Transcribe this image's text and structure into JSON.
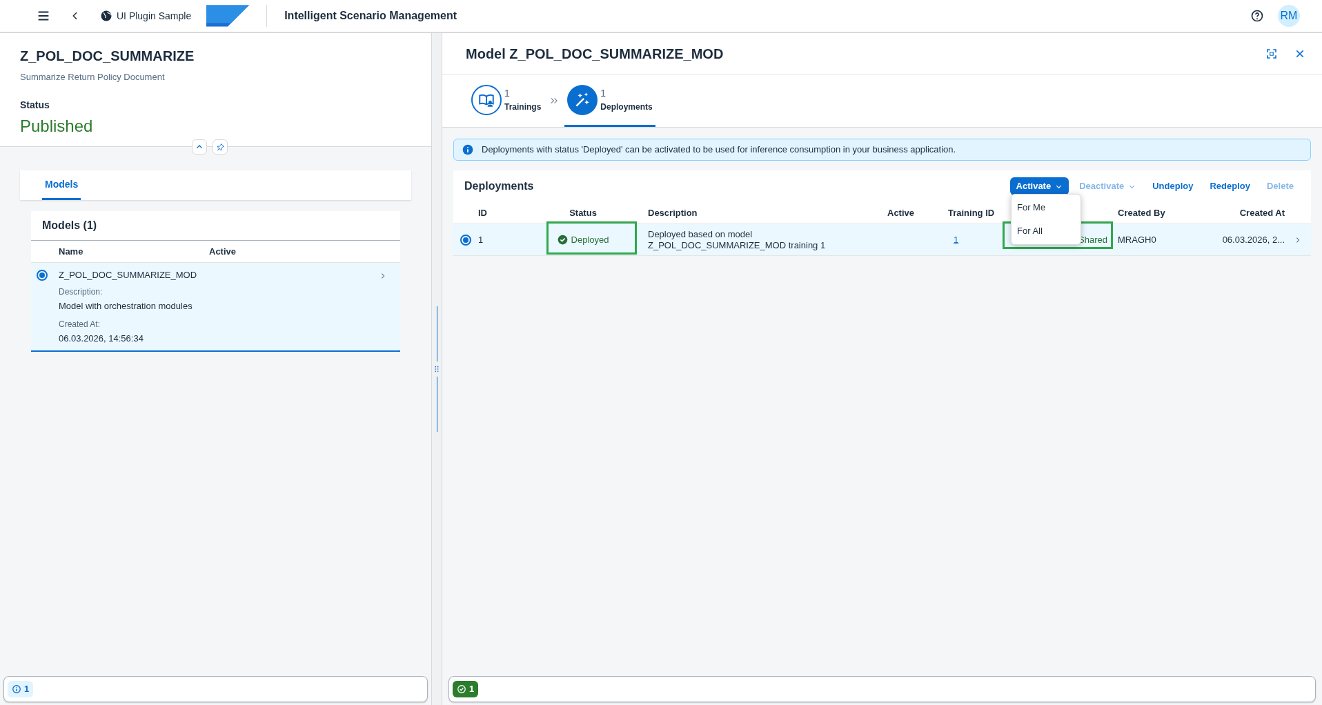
{
  "shell": {
    "app_name": "UI Plugin Sample",
    "title": "Intelligent Scenario Management",
    "avatar": "RM"
  },
  "scenario": {
    "title": "Z_POL_DOC_SUMMARIZE",
    "subtitle": "Summarize Return Policy Document",
    "status_label": "Status",
    "status": "Published"
  },
  "left_tabs": [
    {
      "label": "Models",
      "selected": true
    }
  ],
  "models": {
    "title": "Models (1)",
    "columns": [
      "Name",
      "Active"
    ],
    "rows": [
      {
        "name": "Z_POL_DOC_SUMMARIZE_MOD",
        "selected": true,
        "fields": [
          {
            "label": "Description:",
            "value": "Model with orchestration modules"
          },
          {
            "label": "Created At:",
            "value": "06.03.2026, 14:56:34"
          }
        ]
      }
    ]
  },
  "left_footer": {
    "badge": "1"
  },
  "detail": {
    "title": "Model Z_POL_DOC_SUMMARIZE_MOD",
    "steps": [
      {
        "count": "1",
        "label": "Trainings",
        "kind": "book",
        "selected": false
      },
      {
        "count": "1",
        "label": "Deployments",
        "kind": "wand",
        "selected": true
      }
    ],
    "info": "Deployments with status 'Deployed' can be activated to be used for inference consumption in your business application.",
    "table": {
      "title": "Deployments",
      "actions": [
        {
          "label": "Activate",
          "kind": "menu",
          "primary": true,
          "disabled": false
        },
        {
          "label": "Deactivate",
          "kind": "menu",
          "primary": false,
          "disabled": true
        },
        {
          "label": "Undeploy",
          "kind": "plain",
          "primary": false,
          "disabled": false
        },
        {
          "label": "Redeploy",
          "kind": "plain",
          "primary": false,
          "disabled": false
        },
        {
          "label": "Delete",
          "kind": "plain",
          "primary": false,
          "disabled": true
        }
      ],
      "columns": [
        "ID",
        "Status",
        "Description",
        "Active",
        "Training ID",
        "Created By",
        "Created At"
      ],
      "rows": [
        {
          "selected": true,
          "id": "1",
          "status": "Deployed",
          "description": "Deployed based on model Z_POL_DOC_SUMMARIZE_MOD training 1",
          "training_id": "1",
          "sharing": "Shared",
          "created_by": "MRAGH0",
          "created_at": "06.03.2026, 2..."
        }
      ]
    },
    "menu": [
      "For Me",
      "For All"
    ]
  },
  "right_footer": {
    "badge": "1"
  }
}
